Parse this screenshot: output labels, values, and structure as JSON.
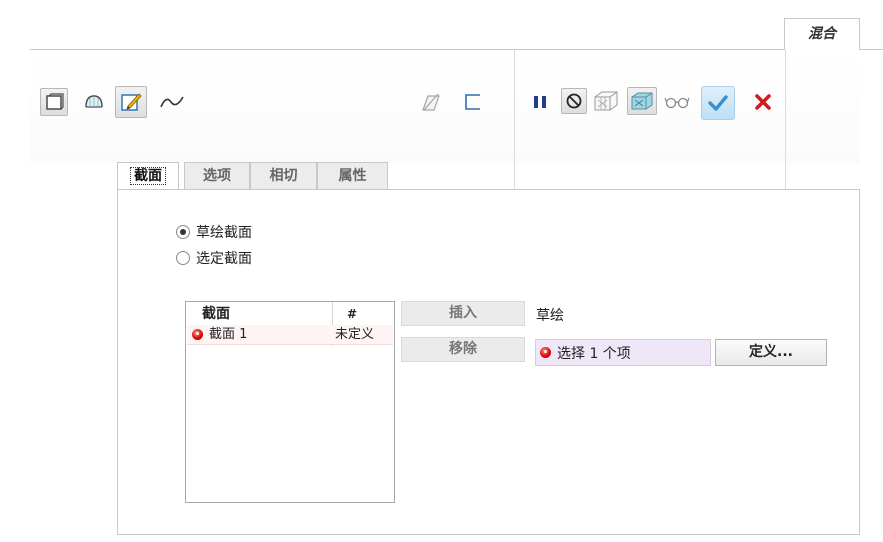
{
  "ribbon": {
    "tab_label": "混合"
  },
  "tabs": [
    {
      "label": "截面",
      "active": true
    },
    {
      "label": "选项",
      "active": false
    },
    {
      "label": "相切",
      "active": false
    },
    {
      "label": "属性",
      "active": false
    }
  ],
  "toolbar": {
    "icons": [
      "solid-feature-icon",
      "surface-feature-icon",
      "sketch-sections-icon",
      "curve-icon",
      "remove-material-icon",
      "thicken-icon",
      "pause-icon",
      "no-preview-icon",
      "preview-geometry-icon",
      "verify-icon",
      "glasses-preview-icon",
      "ok-check-icon",
      "cancel-x-icon"
    ]
  },
  "panel": {
    "radio_sketch": "草绘截面",
    "radio_select": "选定截面",
    "selected_radio": "sketch",
    "list": {
      "col_section": "截面",
      "col_hash": "#",
      "rows": [
        {
          "name": "截面 1",
          "status": "未定义"
        }
      ]
    },
    "insert_button": "插入",
    "remove_button": "移除",
    "sketch_label": "草绘",
    "collector_text": "选择 1 个项",
    "define_button": "定义..."
  },
  "colors": {
    "accent_check": "#3a8fd0",
    "cancel_red": "#d41b1b",
    "collector_bg": "#efe7f7"
  }
}
